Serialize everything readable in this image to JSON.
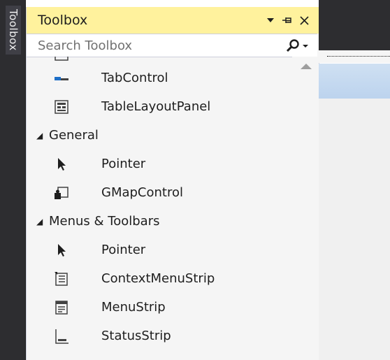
{
  "dock": {
    "tab_label": "Toolbox"
  },
  "toolbox": {
    "title": "Toolbox",
    "search": {
      "placeholder": "Search Toolbox",
      "value": ""
    },
    "rows": [
      {
        "type": "item",
        "label": "TabControl",
        "icon": "tab-control-icon"
      },
      {
        "type": "item",
        "label": "TableLayoutPanel",
        "icon": "table-layout-panel-icon"
      },
      {
        "type": "category",
        "label": "General",
        "expanded": true
      },
      {
        "type": "item",
        "label": "Pointer",
        "icon": "pointer-icon"
      },
      {
        "type": "item",
        "label": "GMapControl",
        "icon": "gmap-control-icon"
      },
      {
        "type": "category",
        "label": "Menus & Toolbars",
        "expanded": true
      },
      {
        "type": "item",
        "label": "Pointer",
        "icon": "pointer-icon"
      },
      {
        "type": "item",
        "label": "ContextMenuStrip",
        "icon": "context-menu-strip-icon"
      },
      {
        "type": "item",
        "label": "MenuStrip",
        "icon": "menu-strip-icon"
      },
      {
        "type": "item",
        "label": "StatusStrip",
        "icon": "status-strip-icon"
      }
    ]
  },
  "colors": {
    "title_bar": "#fff29d",
    "dock_background": "#2d2d30",
    "panel_background": "#f5f5f5"
  }
}
